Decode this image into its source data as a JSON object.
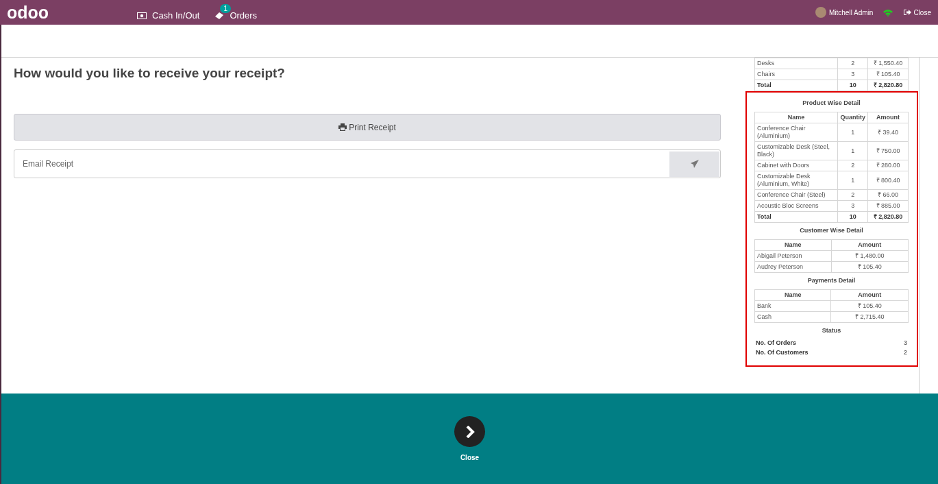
{
  "navbar": {
    "logo": "odoo",
    "items": [
      {
        "label": "Cash In/Out",
        "kind": "cash"
      },
      {
        "label": "Orders",
        "kind": "orders",
        "badge": "1"
      }
    ],
    "user": "Mitchell Admin",
    "close": "Close"
  },
  "receipt_prompt": {
    "title": "How would you like to receive your receipt?",
    "print_button": "Print Receipt",
    "email": {
      "placeholder": "Email Receipt"
    }
  },
  "receipt": {
    "top_table": {
      "rows": [
        [
          "Desks",
          "2",
          "₹ 1,550.40"
        ],
        [
          "Chairs",
          "3",
          "₹ 105.40"
        ]
      ],
      "total": [
        "Total",
        "10",
        "₹ 2,820.80"
      ]
    },
    "sections": [
      {
        "title": "Product Wise Detail",
        "columns": [
          "Name",
          "Quantity",
          "Amount"
        ],
        "rows": [
          [
            "Conference Chair (Aluminium)",
            "1",
            "₹ 39.40"
          ],
          [
            "Customizable Desk (Steel, Black)",
            "1",
            "₹ 750.00"
          ],
          [
            "Cabinet with Doors",
            "2",
            "₹ 280.00"
          ],
          [
            "Customizable Desk (Aluminium, White)",
            "1",
            "₹ 800.40"
          ],
          [
            "Conference Chair (Steel)",
            "2",
            "₹ 66.00"
          ],
          [
            "Acoustic Bloc Screens",
            "3",
            "₹ 885.00"
          ]
        ],
        "total": [
          "Total",
          "10",
          "₹ 2,820.80"
        ]
      },
      {
        "title": "Customer Wise Detail",
        "columns": [
          "Name",
          "Amount"
        ],
        "rows": [
          [
            "Abigail Peterson",
            "₹ 1,480.00"
          ],
          [
            "Audrey Peterson",
            "₹ 105.40"
          ]
        ]
      },
      {
        "title": "Payments Detail",
        "columns": [
          "Name",
          "Amount"
        ],
        "rows": [
          [
            "Bank",
            "₹ 105.40"
          ],
          [
            "Cash",
            "₹ 2,715.40"
          ]
        ]
      }
    ],
    "status": {
      "title": "Status",
      "rows": [
        {
          "label": "No. Of Orders",
          "value": "3"
        },
        {
          "label": "No. Of Customers",
          "value": "2"
        }
      ]
    }
  },
  "footer": {
    "button": "Close"
  }
}
